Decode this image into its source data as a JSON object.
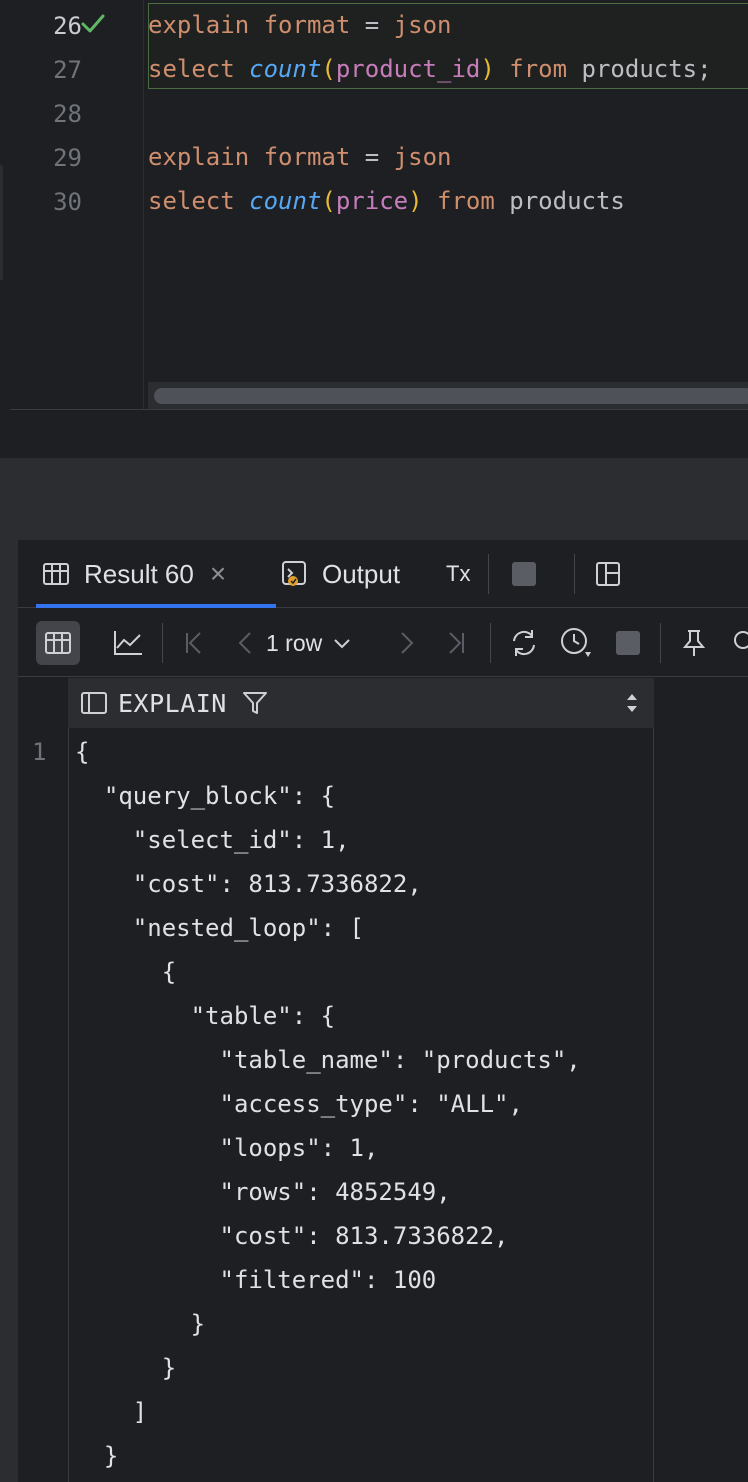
{
  "editor": {
    "gutter": [
      {
        "num": "26",
        "active": true,
        "status_icon": "check-icon"
      },
      {
        "num": "27",
        "active": false
      },
      {
        "num": "28",
        "active": false
      },
      {
        "num": "29",
        "active": false
      },
      {
        "num": "30",
        "active": false
      }
    ],
    "lines": {
      "l1": {
        "kw1": "explain",
        "kw2": "format",
        "op": " = ",
        "kw3": "json"
      },
      "l2": {
        "kw": "select",
        "fn": "count",
        "open": "(",
        "param": "product_id",
        "close": ")",
        "from": "from",
        "table": "products;"
      },
      "l4": {
        "kw1": "explain",
        "kw2": "format",
        "op": " = ",
        "kw3": "json"
      },
      "l5": {
        "kw": "select",
        "fn": "count",
        "open": "(",
        "param": "price",
        "close": ")",
        "from": "from",
        "table": "products"
      }
    }
  },
  "panel": {
    "tabs": {
      "result": {
        "label": "Result 60",
        "icon": "table-icon",
        "close": "×"
      },
      "output": {
        "label": "Output",
        "icon": "console-icon"
      },
      "tx": {
        "label": "Tx",
        "icon": "transaction-icon"
      }
    },
    "toolbar": {
      "rows_label": "1 row"
    },
    "result": {
      "column_header": "EXPLAIN",
      "row_number": "1",
      "json_lines": [
        "{",
        "  \"query_block\": {",
        "    \"select_id\": 1,",
        "    \"cost\": 813.7336822,",
        "    \"nested_loop\": [",
        "      {",
        "        \"table\": {",
        "          \"table_name\": \"products\",",
        "          \"access_type\": \"ALL\",",
        "          \"loops\": 1,",
        "          \"rows\": 4852549,",
        "          \"cost\": 813.7336822,",
        "          \"filtered\": 100",
        "        }",
        "      }",
        "    ]",
        "  }"
      ]
    }
  },
  "colors": {
    "keyword": "#cf8e6d",
    "function": "#56a8f5",
    "parameter": "#c77dbb",
    "paren": "#e8ba36",
    "success": "#5fb865",
    "accent": "#3574f0"
  }
}
